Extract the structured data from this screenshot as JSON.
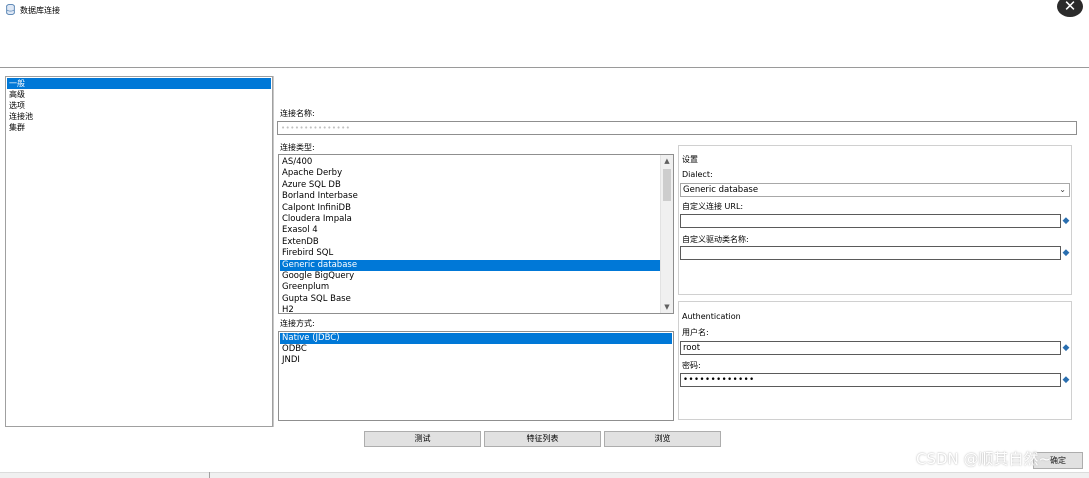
{
  "window": {
    "title": "数据库连接",
    "icon": "database-icon",
    "close_icon": "close-icon"
  },
  "nav": {
    "items": [
      "一般",
      "高级",
      "选项",
      "连接池",
      "集群"
    ],
    "selected_index": 0
  },
  "general": {
    "conn_name_label": "连接名称:",
    "conn_name_value": "•••••••••••••••",
    "conn_type_label": "连接类型:",
    "conn_types": [
      "AS/400",
      "Apache Derby",
      "Azure SQL DB",
      "Borland Interbase",
      "Calpont InfiniDB",
      "Cloudera Impala",
      "Exasol 4",
      "ExtenDB",
      "Firebird SQL",
      "Generic database",
      "Google BigQuery",
      "Greenplum",
      "Gupta SQL Base",
      "H2"
    ],
    "conn_type_selected": 9,
    "access_label": "连接方式:",
    "access_methods": [
      "Native (JDBC)",
      "ODBC",
      "JNDI"
    ],
    "access_selected": 0
  },
  "settings": {
    "group_label": "设置",
    "dialect_label": "Dialect:",
    "dialect_value": "Generic database",
    "custom_url_label": "自定义连接 URL:",
    "custom_url_value": "",
    "custom_driver_label": "自定义驱动类名称:",
    "custom_driver_value": ""
  },
  "auth": {
    "group_label": "Authentication",
    "username_label": "用户名:",
    "username_value": "root",
    "password_label": "密码:",
    "password_value": "•••••••••••••"
  },
  "buttons": {
    "test": "测试",
    "feature_list": "特征列表",
    "browse": "浏览"
  },
  "watermark": "CSDN @顺其自然~",
  "corner_button": "确定",
  "colors": {
    "selection": "#0078d7",
    "button_face": "#e1e1e1",
    "variable_icon": "#2a6fb0"
  }
}
